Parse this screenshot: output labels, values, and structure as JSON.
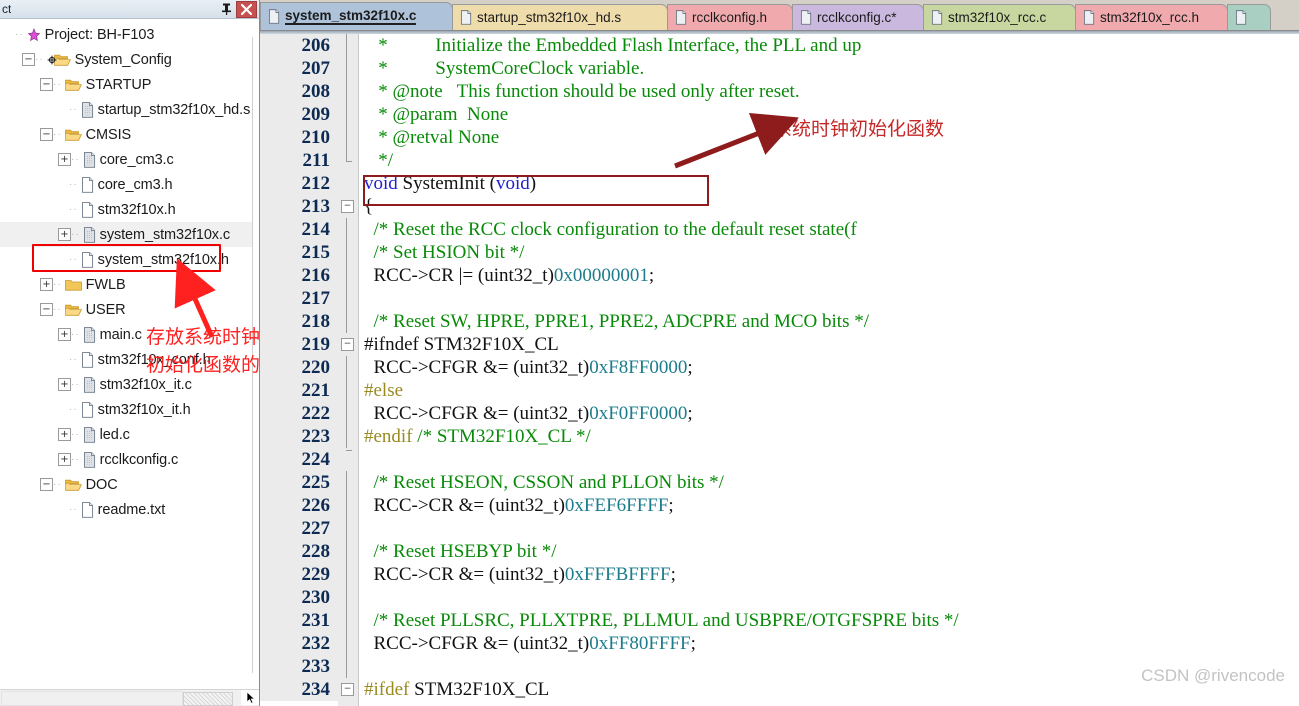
{
  "panel": {
    "title": "ct",
    "pin_icon": "pin-icon",
    "close_icon": "close-icon",
    "close_label": "✖",
    "pin_label": "⌶"
  },
  "tree": [
    {
      "depth": 0,
      "label": "Project: BH-F103",
      "icon": "project-icon",
      "expander": "none"
    },
    {
      "depth": 1,
      "label": "System_Config",
      "icon": "target-folder-icon",
      "expander": "minus"
    },
    {
      "depth": 2,
      "label": "STARTUP",
      "icon": "folder-icon",
      "expander": "minus"
    },
    {
      "depth": 3,
      "label": "startup_stm32f10x_hd.s",
      "icon": "file-asm-icon",
      "expander": "none"
    },
    {
      "depth": 2,
      "label": "CMSIS",
      "icon": "folder-icon",
      "expander": "minus"
    },
    {
      "depth": 3,
      "label": "core_cm3.c",
      "icon": "file-c-icon",
      "expander": "plus"
    },
    {
      "depth": 3,
      "label": "core_cm3.h",
      "icon": "file-h-icon",
      "expander": "none"
    },
    {
      "depth": 3,
      "label": "stm32f10x.h",
      "icon": "file-h-icon",
      "expander": "none"
    },
    {
      "depth": 3,
      "label": "system_stm32f10x.c",
      "icon": "file-c-icon",
      "expander": "plus",
      "selected": true
    },
    {
      "depth": 3,
      "label": "system_stm32f10x.h",
      "icon": "file-h-icon",
      "expander": "none"
    },
    {
      "depth": 2,
      "label": "FWLB",
      "icon": "folder-closed-icon",
      "expander": "plus"
    },
    {
      "depth": 2,
      "label": "USER",
      "icon": "folder-icon",
      "expander": "minus"
    },
    {
      "depth": 3,
      "label": "main.c",
      "icon": "file-c-icon",
      "expander": "plus"
    },
    {
      "depth": 3,
      "label": "stm32f10x_conf.h",
      "icon": "file-h-icon",
      "expander": "none"
    },
    {
      "depth": 3,
      "label": "stm32f10x_it.c",
      "icon": "file-c-icon",
      "expander": "plus"
    },
    {
      "depth": 3,
      "label": "stm32f10x_it.h",
      "icon": "file-h-icon",
      "expander": "none"
    },
    {
      "depth": 3,
      "label": "led.c",
      "icon": "file-c-icon",
      "expander": "plus"
    },
    {
      "depth": 3,
      "label": "rcclkconfig.c",
      "icon": "file-c-icon",
      "expander": "plus"
    },
    {
      "depth": 2,
      "label": "DOC",
      "icon": "folder-icon",
      "expander": "minus"
    },
    {
      "depth": 3,
      "label": "readme.txt",
      "icon": "file-txt-icon",
      "expander": "none"
    }
  ],
  "tabs": [
    {
      "label": "system_stm32f10x.c",
      "color": "#aec3d9",
      "active": true
    },
    {
      "label": "startup_stm32f10x_hd.s",
      "color": "#efdcab",
      "active": false
    },
    {
      "label": "rcclkconfig.h",
      "color": "#f0aaae",
      "active": false
    },
    {
      "label": "rcclkconfig.c*",
      "color": "#cbb8de",
      "active": false
    },
    {
      "label": "stm32f10x_rcc.c",
      "color": "#c8d6a0",
      "active": false
    },
    {
      "label": "stm32f10x_rcc.h",
      "color": "#f0aaae",
      "active": false
    },
    {
      "label": "",
      "color": "#a8cfc2",
      "active": false
    }
  ],
  "code": [
    {
      "n": "206",
      "fold": "bar",
      "tokens": [
        {
          "t": "   *          ",
          "c": "cm"
        },
        {
          "t": "Initialize the Embedded Flash Interface, the PLL and up",
          "c": "cm"
        }
      ]
    },
    {
      "n": "207",
      "fold": "bar",
      "tokens": [
        {
          "t": "   *          SystemCoreClock variable.",
          "c": "cm"
        }
      ]
    },
    {
      "n": "208",
      "fold": "bar",
      "tokens": [
        {
          "t": "   * @note   This function should be used only after reset.",
          "c": "cm"
        }
      ]
    },
    {
      "n": "209",
      "fold": "bar",
      "tokens": [
        {
          "t": "   * @param  None",
          "c": "cm"
        }
      ]
    },
    {
      "n": "210",
      "fold": "bar",
      "tokens": [
        {
          "t": "   * @retval None",
          "c": "cm"
        }
      ]
    },
    {
      "n": "211",
      "fold": "end",
      "tokens": [
        {
          "t": "   */",
          "c": "cm"
        }
      ]
    },
    {
      "n": "212",
      "fold": "none",
      "tokens": [
        {
          "t": "void",
          "c": "kw"
        },
        {
          "t": " SystemInit (",
          "c": "pl"
        },
        {
          "t": "void",
          "c": "kw"
        },
        {
          "t": ")",
          "c": "pl"
        }
      ]
    },
    {
      "n": "213",
      "fold": "minus",
      "tokens": [
        {
          "t": "{",
          "c": "pl"
        }
      ]
    },
    {
      "n": "214",
      "fold": "bar",
      "tokens": [
        {
          "t": "  /* Reset the RCC clock configuration to the default reset state(f",
          "c": "cm"
        }
      ]
    },
    {
      "n": "215",
      "fold": "bar",
      "tokens": [
        {
          "t": "  /* Set HSION bit */",
          "c": "cm"
        }
      ]
    },
    {
      "n": "216",
      "fold": "bar",
      "tokens": [
        {
          "t": "  RCC->CR |= (uint32_t)",
          "c": "pl"
        },
        {
          "t": "0x00000001",
          "c": "num"
        },
        {
          "t": ";",
          "c": "pl"
        }
      ]
    },
    {
      "n": "217",
      "fold": "bar",
      "tokens": [
        {
          "t": "",
          "c": "pl"
        }
      ]
    },
    {
      "n": "218",
      "fold": "bar",
      "tokens": [
        {
          "t": "  /* Reset SW, HPRE, PPRE1, PPRE2, ADCPRE and MCO bits */",
          "c": "cm"
        }
      ]
    },
    {
      "n": "219",
      "fold": "minus",
      "tokens": [
        {
          "t": "#ifndef",
          "c": "pl"
        },
        {
          "t": " STM32F10X_CL",
          "c": "pl"
        }
      ]
    },
    {
      "n": "220",
      "fold": "bar",
      "tokens": [
        {
          "t": "  RCC->CFGR &= (uint32_t)",
          "c": "pl"
        },
        {
          "t": "0xF8FF0000",
          "c": "num"
        },
        {
          "t": ";",
          "c": "pl"
        }
      ]
    },
    {
      "n": "221",
      "fold": "bar",
      "tokens": [
        {
          "t": "#else",
          "c": "pre"
        }
      ]
    },
    {
      "n": "222",
      "fold": "bar",
      "tokens": [
        {
          "t": "  RCC->CFGR &= (uint32_t)",
          "c": "pl"
        },
        {
          "t": "0xF0FF0000",
          "c": "num"
        },
        {
          "t": ";",
          "c": "pl"
        }
      ]
    },
    {
      "n": "223",
      "fold": "bar",
      "tokens": [
        {
          "t": "#endif",
          "c": "pre"
        },
        {
          "t": " /* STM32F10X_CL */",
          "c": "cm"
        }
      ]
    },
    {
      "n": "224",
      "fold": "endtop",
      "tokens": [
        {
          "t": "",
          "c": "pl"
        }
      ]
    },
    {
      "n": "225",
      "fold": "bar",
      "tokens": [
        {
          "t": "  /* Reset HSEON, CSSON and PLLON bits */",
          "c": "cm"
        }
      ]
    },
    {
      "n": "226",
      "fold": "bar",
      "tokens": [
        {
          "t": "  RCC->CR &= (uint32_t)",
          "c": "pl"
        },
        {
          "t": "0xFEF6FFFF",
          "c": "num"
        },
        {
          "t": ";",
          "c": "pl"
        }
      ]
    },
    {
      "n": "227",
      "fold": "bar",
      "tokens": [
        {
          "t": "",
          "c": "pl"
        }
      ]
    },
    {
      "n": "228",
      "fold": "bar",
      "tokens": [
        {
          "t": "  /* Reset HSEBYP bit */",
          "c": "cm"
        }
      ]
    },
    {
      "n": "229",
      "fold": "bar",
      "tokens": [
        {
          "t": "  RCC->CR &= (uint32_t)",
          "c": "pl"
        },
        {
          "t": "0xFFFBFFFF",
          "c": "num"
        },
        {
          "t": ";",
          "c": "pl"
        }
      ]
    },
    {
      "n": "230",
      "fold": "bar",
      "tokens": [
        {
          "t": "",
          "c": "pl"
        }
      ]
    },
    {
      "n": "231",
      "fold": "bar",
      "tokens": [
        {
          "t": "  /* Reset PLLSRC, PLLXTPRE, PLLMUL and USBPRE/OTGFSPRE bits */",
          "c": "cm"
        }
      ]
    },
    {
      "n": "232",
      "fold": "bar",
      "tokens": [
        {
          "t": "  RCC->CFGR &= (uint32_t)",
          "c": "pl"
        },
        {
          "t": "0xFF80FFFF",
          "c": "num"
        },
        {
          "t": ";",
          "c": "pl"
        }
      ]
    },
    {
      "n": "233",
      "fold": "bar",
      "tokens": [
        {
          "t": "",
          "c": "pl"
        }
      ]
    },
    {
      "n": "234",
      "fold": "minus",
      "tokens": [
        {
          "t": "#ifdef",
          "c": "pre"
        },
        {
          "t": " STM32F10X_CL",
          "c": "pl"
        }
      ]
    }
  ],
  "annotations": {
    "tree_note_line1": "存放系统时钟",
    "tree_note_line2": "初始化函数的文件",
    "code_note": "系统时钟初始化函数"
  },
  "watermark": "CSDN @rivencode",
  "colors": {
    "comment": "#088a08",
    "keyword": "#2020d0",
    "number": "#1c7c8c",
    "preproc": "#9a8a20",
    "annotation_red": "#ff2020",
    "annotation_dark_red": "#8e1c1c",
    "gutter_bg": "#ebebeb",
    "tabbar_bg": "#d4d0c8"
  }
}
